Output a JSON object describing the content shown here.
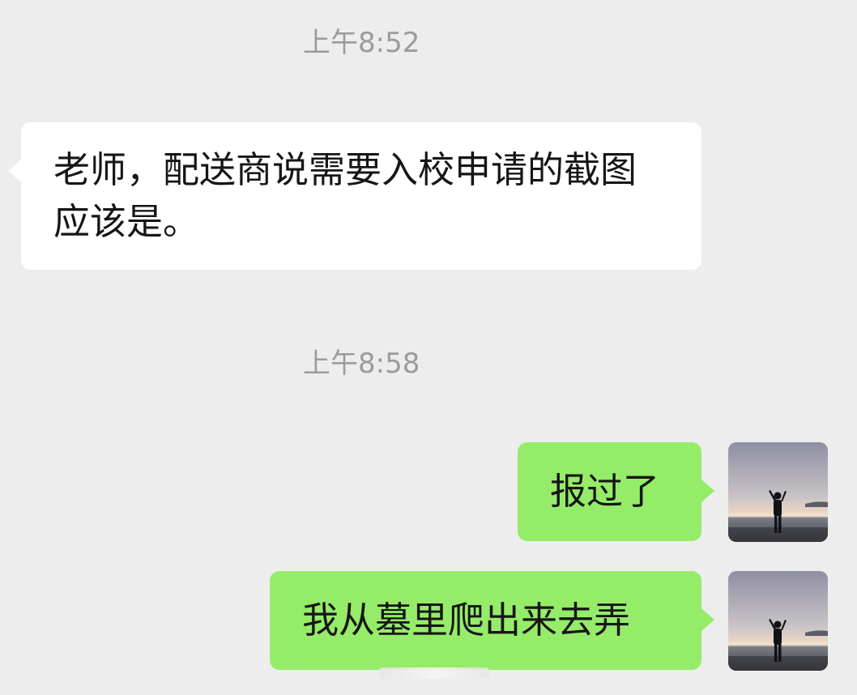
{
  "chat": {
    "messages": [
      {
        "timestamp": "上午8:52",
        "direction": "incoming",
        "text": "老师，配送商说需要入校申请的截图应该是。"
      },
      {
        "timestamp": "上午8:58",
        "direction": "outgoing",
        "text": "报过了"
      },
      {
        "direction": "outgoing",
        "text": "我从墓里爬出来去弄"
      }
    ],
    "colors": {
      "background": "#ededed",
      "incoming_bubble": "#ffffff",
      "outgoing_bubble": "#95ec69",
      "timestamp_text": "#9b9b9b"
    },
    "avatar_icon": "sunset-beach-photo-avatar"
  }
}
